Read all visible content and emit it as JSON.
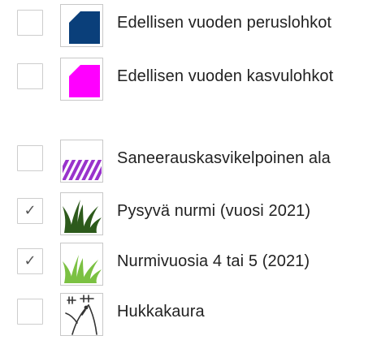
{
  "layers": [
    {
      "label": "Edellisen vuoden peruslohkot",
      "checked": false,
      "symbol": "parcel-base-icon",
      "color": "#0a3f7a"
    },
    {
      "label": "Edellisen vuoden kasvulohkot",
      "checked": false,
      "symbol": "parcel-growth-icon",
      "color": "#ff00ff"
    },
    {
      "label": "Saneerauskasvikelpoinen ala",
      "checked": false,
      "symbol": "hatched-area-icon",
      "color": "#9933cc"
    },
    {
      "label": "Pysyvä nurmi (vuosi 2021)",
      "checked": true,
      "symbol": "grass-dark-icon",
      "color": "#2d5a1b"
    },
    {
      "label": "Nurmivuosia 4 tai 5 (2021)",
      "checked": true,
      "symbol": "grass-light-icon",
      "color": "#7bc142"
    },
    {
      "label": "Hukkakaura",
      "checked": false,
      "symbol": "wild-oat-icon",
      "color": "#333333"
    }
  ],
  "check_glyph": "✓"
}
